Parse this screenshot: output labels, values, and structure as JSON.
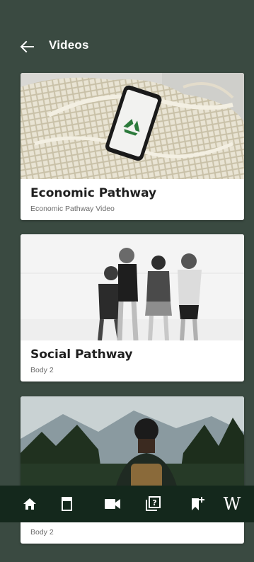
{
  "appbar": {
    "title": "Videos",
    "back_icon": "arrow-left-icon"
  },
  "cards": [
    {
      "title": "Economic Pathway",
      "subtitle": "Economic Pathway Video",
      "image": "recycle-phone-on-mesh-bag"
    },
    {
      "title": "Social Pathway",
      "subtitle": "Body 2",
      "image": "four-women-laughing"
    },
    {
      "title": "",
      "subtitle": "Body 2",
      "image": "man-with-backpack-facing-mountains"
    }
  ],
  "bottom_nav": {
    "items": [
      {
        "icon": "home-icon"
      },
      {
        "icon": "book-icon"
      },
      {
        "icon": "video-camera-icon"
      },
      {
        "icon": "quiz-icon"
      },
      {
        "icon": "bookmark-add-icon"
      },
      {
        "icon": "wikipedia-icon",
        "label": "W"
      }
    ]
  },
  "colors": {
    "background": "#3a4a41",
    "bottom_nav": "#14281c",
    "card": "#ffffff"
  }
}
